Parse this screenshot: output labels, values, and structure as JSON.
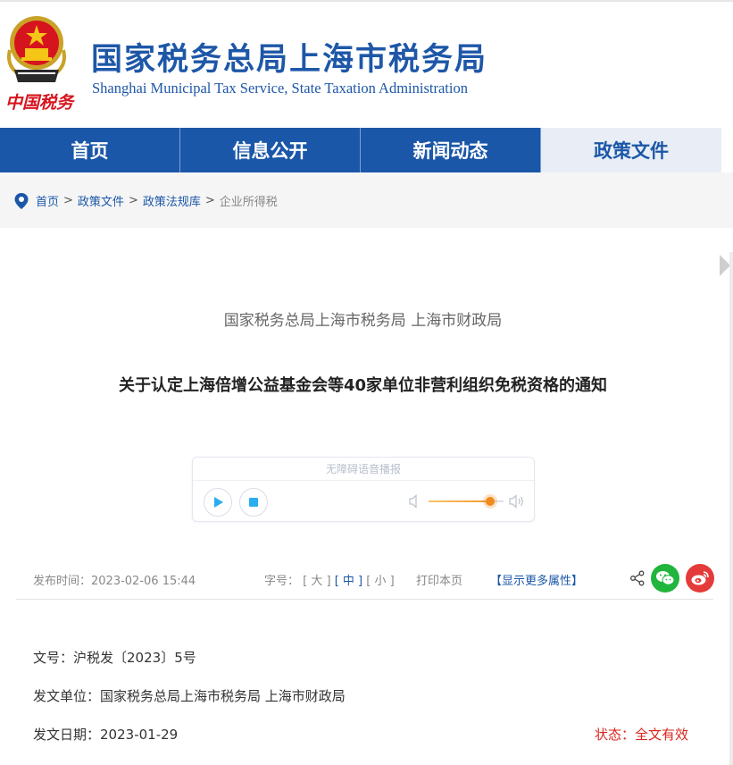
{
  "header": {
    "emblem_caption": "中国税务",
    "title": "国家税务总局上海市税务局",
    "subtitle": "Shanghai Municipal Tax Service, State Taxation Administration"
  },
  "nav": {
    "items": [
      {
        "label": "首页"
      },
      {
        "label": "信息公开"
      },
      {
        "label": "新闻动态"
      },
      {
        "label": "政策文件"
      }
    ],
    "active_index": 3
  },
  "breadcrumb": {
    "items": [
      "首页",
      "政策文件",
      "政策法规库"
    ],
    "separator": ">",
    "current": "企业所得税"
  },
  "article": {
    "issuer": "国家税务总局上海市税务局 上海市财政局",
    "title": "关于认定上海倍增公益基金会等40家单位非营利组织免税资格的通知"
  },
  "player": {
    "label": "无障碍语音播报",
    "volume": 0.82
  },
  "meta": {
    "publish_label": "发布时间：",
    "publish_time": "2023-02-06 15:44",
    "font_size_label": "字号：",
    "font_large": "[ 大 ]",
    "font_medium": "[ 中 ]",
    "font_small": "[ 小 ]",
    "print_label": "打印本页",
    "more_label": "【显示更多属性】"
  },
  "info": {
    "doc_no_label": "文号：",
    "doc_no": "沪税发〔2023〕5号",
    "issuer_label": "发文单位：",
    "issuer": "国家税务总局上海市税务局 上海市财政局",
    "date_label": "发文日期：",
    "date": "2023-01-29",
    "status_label": "状态：",
    "status": "全文有效"
  },
  "colors": {
    "brand_blue": "#1b57a8",
    "status_red": "#d8261d",
    "wechat_green": "#20b53c",
    "weibo_red": "#e53a3a"
  }
}
